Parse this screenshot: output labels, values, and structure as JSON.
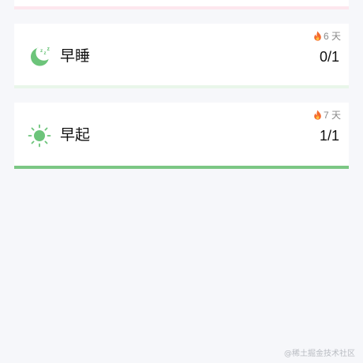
{
  "colors": {
    "background": "#f6f7fa",
    "card": "#ffffff",
    "accent_green": "#7bc784",
    "top_card_bar": "#fde7ee",
    "streak_text": "#8a8a8a"
  },
  "habits": [
    {
      "icon": "moon-sleep-icon",
      "title": "早睡",
      "count": "0/1",
      "streak": "6 天",
      "progress": 0
    },
    {
      "icon": "sun-icon",
      "title": "早起",
      "count": "1/1",
      "streak": "7 天",
      "progress": 1
    }
  ],
  "watermark": "@稀土掘金技术社区"
}
